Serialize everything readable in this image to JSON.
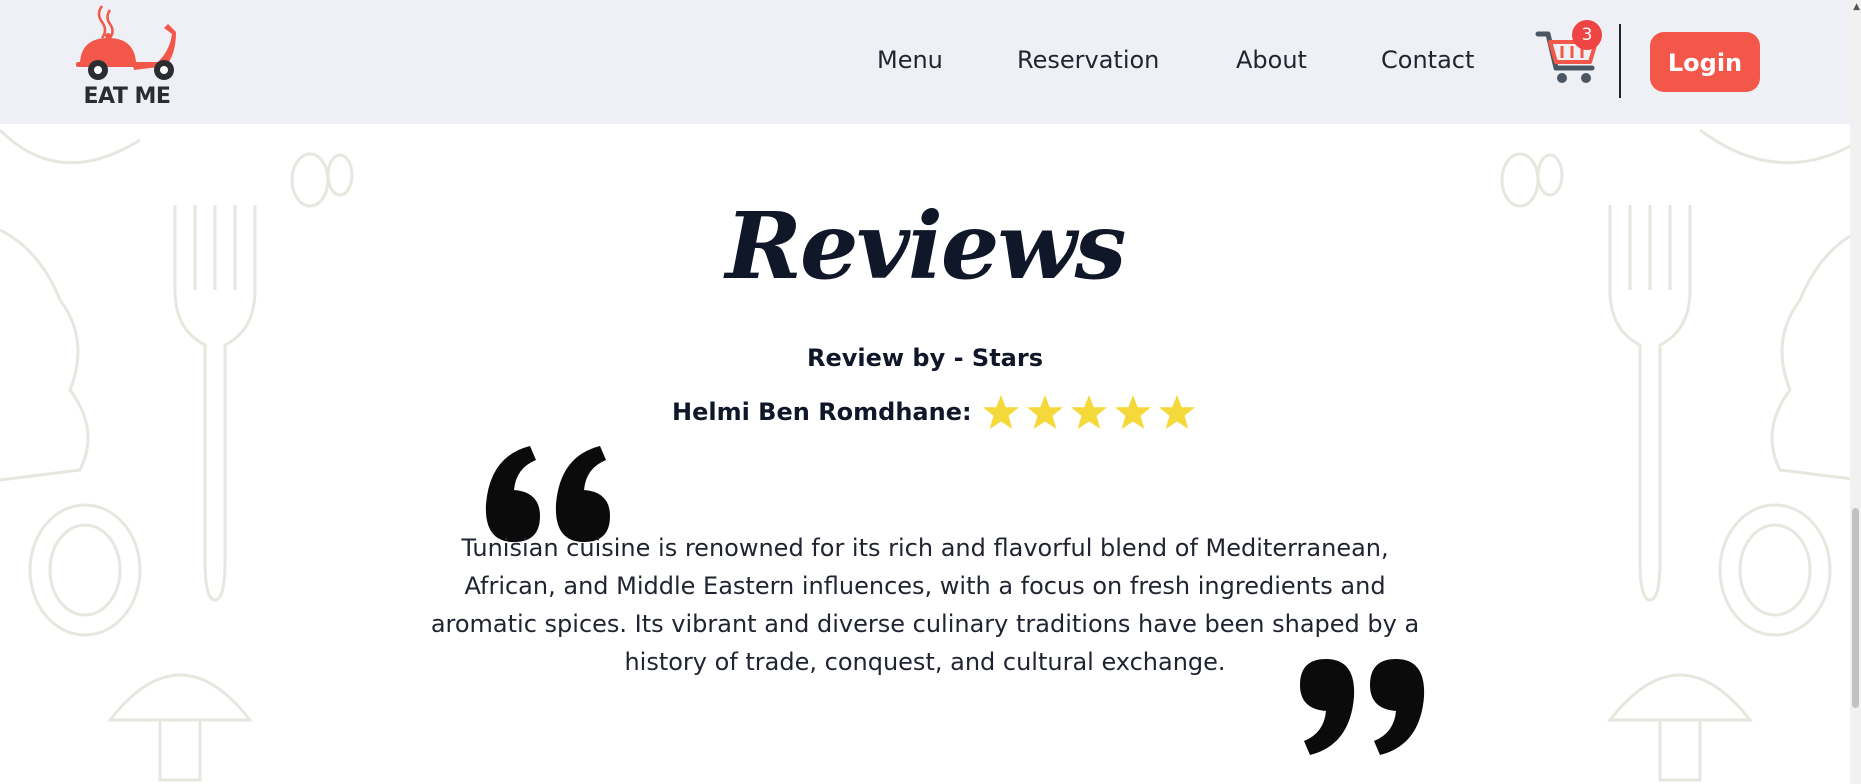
{
  "brand": {
    "name": "EAT ME",
    "logo_icon": "delivery-scooter-icon",
    "accent": "#f2574a"
  },
  "nav": {
    "links": [
      "Menu",
      "Reservation",
      "About",
      "Contact"
    ],
    "cart_count": "3",
    "login_label": "Login"
  },
  "reviews": {
    "title": "Reviews",
    "subtitle": "Review by - Stars",
    "reviewer": "Helmi Ben Romdhane:",
    "stars": 5,
    "star_color": "#f5d93b",
    "text": "Tunisian cuisine is renowned for its rich and flavorful blend of Mediterranean, African, and Middle Eastern influences, with a focus on fresh ingredients and aromatic spices. Its vibrant and diverse culinary traditions have been shaped by a history of trade, conquest, and cultural exchange."
  }
}
